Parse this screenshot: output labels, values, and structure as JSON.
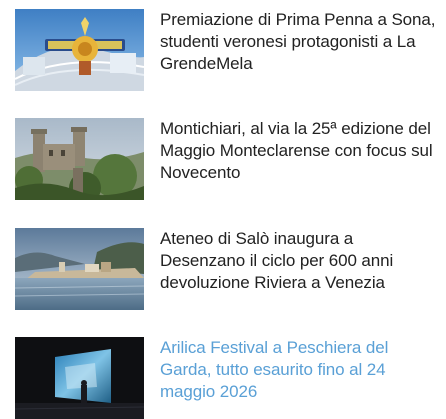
{
  "articles": [
    {
      "title": "Premiazione di Prima Penna a Sona, studenti veronesi protagonisti a La GrendeMela",
      "thumbnail_icon": "amusement-park-photo"
    },
    {
      "title": "Montichiari, al via la 25ª edizione del Maggio Monteclarense con focus sul Novecento",
      "thumbnail_icon": "castle-photo"
    },
    {
      "title": "Ateneo di Salò inaugura a Desenzano il ciclo per 600 anni devoluzione Riviera a Venezia",
      "thumbnail_icon": "lake-town-photo"
    },
    {
      "title": "Arilica Festival a Peschiera del Garda, tutto esaurito fino al 24 maggio 2026",
      "thumbnail_icon": "stage-screen-photo"
    }
  ],
  "colors": {
    "title_default": "#222222",
    "title_active": "#5aa0d6"
  }
}
